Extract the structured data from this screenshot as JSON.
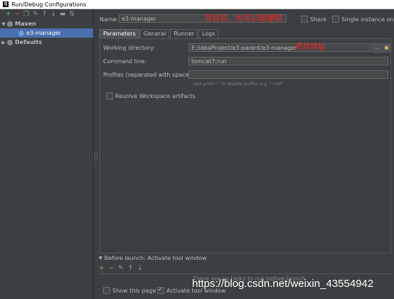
{
  "window": {
    "title": "Run/Debug Configurations",
    "app_icon_text": "IJ"
  },
  "toolbar": {
    "icons": [
      "add-icon",
      "remove-icon",
      "copy-icon",
      "wrench-icon",
      "move-up-icon",
      "move-down-icon",
      "folder-icon",
      "sort-icon"
    ]
  },
  "tree": {
    "maven_label": "Maven",
    "e3_label": "e3-manager",
    "defaults_label": "Defaults"
  },
  "name": {
    "label": "Name:",
    "value": "e3-manager",
    "share_label": "Share",
    "single_instance_label": "Single instance only"
  },
  "annotations": {
    "name_note": "项目名，也可以随便取",
    "dir_note": "项目地址"
  },
  "tabs": [
    "Parameters",
    "General",
    "Runner",
    "Logs"
  ],
  "params": {
    "workdir_label": "Working directory:",
    "workdir_value": "E:/ideaProject/e3-parent/e3-manager",
    "browse_label": "...",
    "cmd_label": "Command line:",
    "cmd_value": "tomcat7:run",
    "profiles_label": "Profiles (separated with space):",
    "profiles_hint": "add prefix '-' to disable profile, e.g. \"-test\"",
    "resolve_label": "Resolve Workspace artifacts"
  },
  "before_launch": {
    "header": "Before launch: Activate tool window",
    "empty_text": "There are no tasks to run before launch"
  },
  "bottom": {
    "show_page_label": "Show this page",
    "activate_label": "Activate tool window"
  },
  "watermark": "https://blog.csdn.net/weixin_43554942",
  "colors": {
    "background": "#3c3f41",
    "selection": "#4b6eaf",
    "annotation": "#ff2222"
  }
}
